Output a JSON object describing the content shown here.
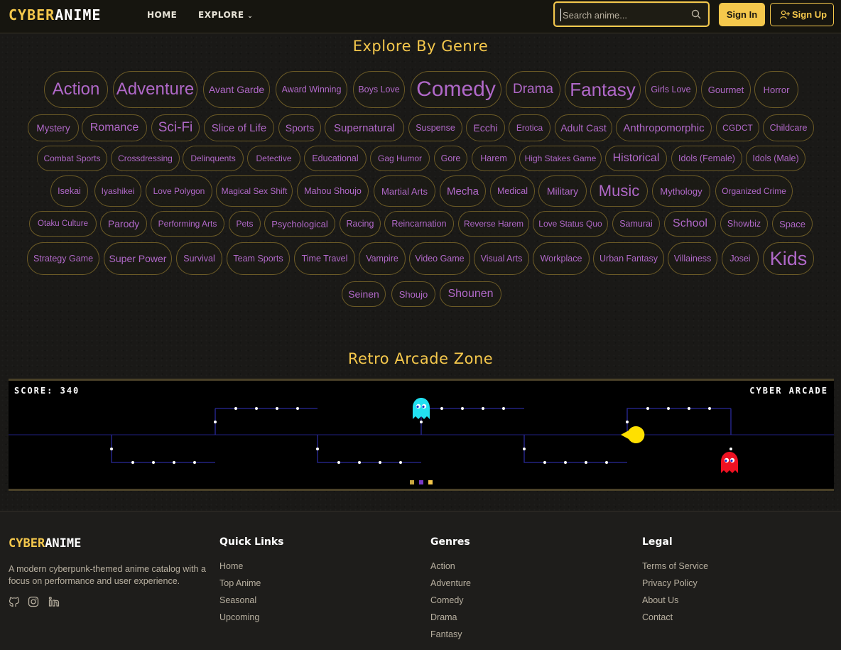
{
  "header": {
    "logo_part1": "CYBER",
    "logo_part2": "ANIME",
    "nav_home": "HOME",
    "nav_explore": "EXPLORE",
    "search_placeholder": "Search anime...",
    "signin": "Sign In",
    "signup": "Sign Up"
  },
  "genres_section": {
    "title": "Explore By Genre",
    "items": [
      "Action",
      "Adventure",
      "Avant Garde",
      "Award Winning",
      "Boys Love",
      "Comedy",
      "Drama",
      "Fantasy",
      "Girls Love",
      "Gourmet",
      "Horror",
      "Mystery",
      "Romance",
      "Sci-Fi",
      "Slice of Life",
      "Sports",
      "Supernatural",
      "Suspense",
      "Ecchi",
      "Erotica",
      "Adult Cast",
      "Anthropomorphic",
      "CGDCT",
      "Childcare",
      "Combat Sports",
      "Crossdressing",
      "Delinquents",
      "Detective",
      "Educational",
      "Gag Humor",
      "Gore",
      "Harem",
      "High Stakes Game",
      "Historical",
      "Idols (Female)",
      "Idols (Male)",
      "Isekai",
      "Iyashikei",
      "Love Polygon",
      "Magical Sex Shift",
      "Mahou Shoujo",
      "Martial Arts",
      "Mecha",
      "Medical",
      "Military",
      "Music",
      "Mythology",
      "Organized Crime",
      "Otaku Culture",
      "Parody",
      "Performing Arts",
      "Pets",
      "Psychological",
      "Racing",
      "Reincarnation",
      "Reverse Harem",
      "Love Status Quo",
      "Samurai",
      "School",
      "Showbiz",
      "Space",
      "Strategy Game",
      "Super Power",
      "Survival",
      "Team Sports",
      "Time Travel",
      "Vampire",
      "Video Game",
      "Visual Arts",
      "Workplace",
      "Urban Fantasy",
      "Villainess",
      "Josei",
      "Kids",
      "Seinen",
      "Shoujo",
      "Shounen"
    ]
  },
  "arcade": {
    "title": "Retro Arcade Zone",
    "score_label": "SCORE:",
    "score_value": "340",
    "brand": "CYBER ARCADE",
    "colors": {
      "path": "#2a2a9a",
      "pellet": "#ffffff",
      "ghost_cyan": "#22e0f0",
      "ghost_red": "#ee1122",
      "pacman": "#ffe000"
    }
  },
  "footer": {
    "logo_part1": "CYBER",
    "logo_part2": "ANIME",
    "description": "A modern cyberpunk-themed anime catalog with a focus on performance and user experience.",
    "socials": [
      "github-icon",
      "instagram-icon",
      "linkedin-icon"
    ],
    "columns": [
      {
        "heading": "Quick Links",
        "links": [
          "Home",
          "Top Anime",
          "Seasonal",
          "Upcoming"
        ]
      },
      {
        "heading": "Genres",
        "links": [
          "Action",
          "Adventure",
          "Comedy",
          "Drama",
          "Fantasy"
        ]
      },
      {
        "heading": "Legal",
        "links": [
          "Terms of Service",
          "Privacy Policy",
          "About Us",
          "Contact"
        ]
      }
    ]
  },
  "colors": {
    "accent": "#f5c84c",
    "genre_text": "#b068c8",
    "pill_border": "#6b5a26"
  }
}
